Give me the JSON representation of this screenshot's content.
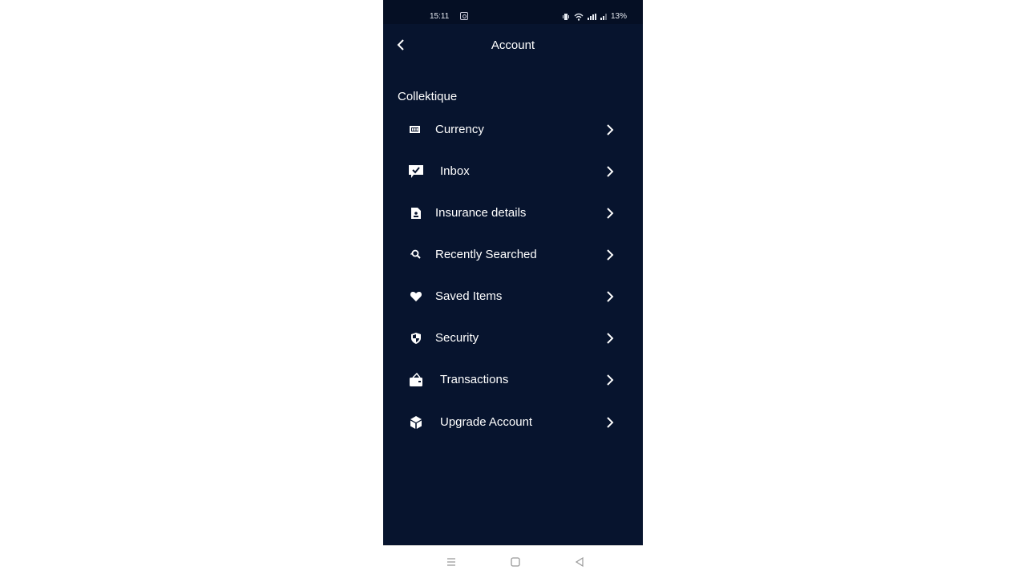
{
  "status_bar": {
    "time": "15:11",
    "battery": "13%"
  },
  "header": {
    "title": "Account",
    "back_icon": "chevron-left-icon"
  },
  "section": {
    "title": "Collektique"
  },
  "menu": [
    {
      "label": "Currency",
      "icon": "money-icon"
    },
    {
      "label": "Inbox",
      "icon": "chat-check-icon"
    },
    {
      "label": "Insurance details",
      "icon": "contact-document-icon"
    },
    {
      "label": "Recently Searched",
      "icon": "search-history-icon"
    },
    {
      "label": "Saved Items",
      "icon": "heart-icon"
    },
    {
      "label": "Security",
      "icon": "shield-icon"
    },
    {
      "label": "Transactions",
      "icon": "wallet-icon"
    },
    {
      "label": "Upgrade Account",
      "icon": "cube-icon"
    }
  ],
  "nav_bar": {
    "buttons": [
      "recent-apps",
      "home",
      "back"
    ]
  },
  "colors": {
    "background": "#07142e",
    "status_bar": "#050f24",
    "text": "#ffffff"
  }
}
